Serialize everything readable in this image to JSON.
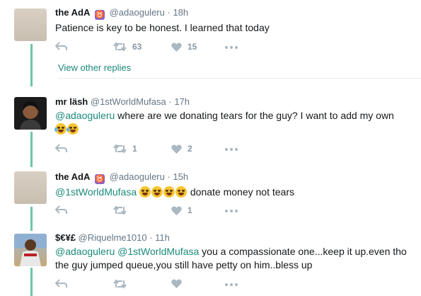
{
  "tweets": [
    {
      "name": "the AdA",
      "badge": "♉",
      "handle": "@adaoguleru",
      "time": "· 18h",
      "text": "Patience is key to be honest. I learned that today",
      "retweets": "63",
      "likes": "15"
    },
    {
      "name": "mr läsh",
      "handle": "@1stWorldMufasa",
      "time": "· 17h",
      "mention": "@adaoguleru",
      "text": " where are we donating tears for the guy? I want to add my own",
      "retweets": "1",
      "likes": "2"
    },
    {
      "name": "the AdA",
      "badge": "♉",
      "handle": "@adaoguleru",
      "time": "· 15h",
      "mention": "@1stWorldMufasa",
      "text": " donate money not tears",
      "retweets": "",
      "likes": "1"
    },
    {
      "name": "$€¥£",
      "handle": "@Riquelme1010",
      "time": "· 11h",
      "mention": "@adaoguleru @1stWorldMufasa",
      "text": " you a compassionate one...keep it up.even tho the guy jumped queue,you still have petty on him..bless up",
      "retweets": "",
      "likes": ""
    }
  ],
  "view_other_replies": "View other replies",
  "colors": {
    "accent": "#1b8a7a",
    "thread_line": "#6ec6a8",
    "icon": "#aab8c2"
  }
}
